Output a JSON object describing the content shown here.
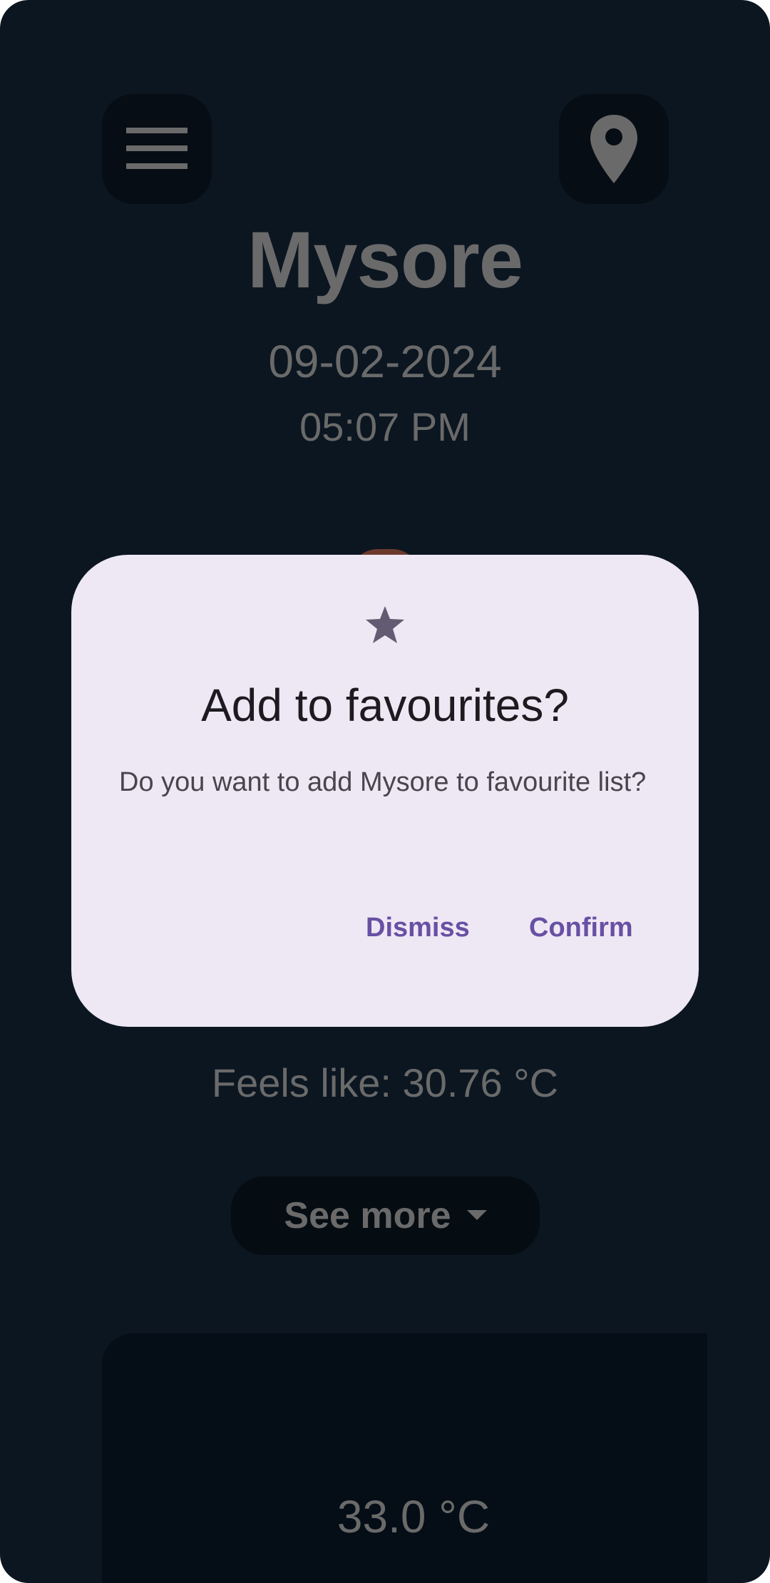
{
  "header": {
    "menu_icon": "hamburger-menu-icon",
    "location_icon": "location-pin-icon",
    "city": "Mysore",
    "date": "09-02-2024",
    "time": "05:07 PM"
  },
  "weather": {
    "feels_like": "Feels like: 30.76 °C",
    "see_more_label": "See more",
    "see_more_icon": "caret-down-icon",
    "card_temp": "33.0 °C"
  },
  "dialog": {
    "icon": "star-icon",
    "title": "Add to favourites?",
    "message": "Do you want to add Mysore to favourite list?",
    "dismiss_label": "Dismiss",
    "confirm_label": "Confirm"
  },
  "colors": {
    "background": "#0b1621",
    "dialog_surface": "#eee8f4",
    "accent": "#6750a4"
  }
}
